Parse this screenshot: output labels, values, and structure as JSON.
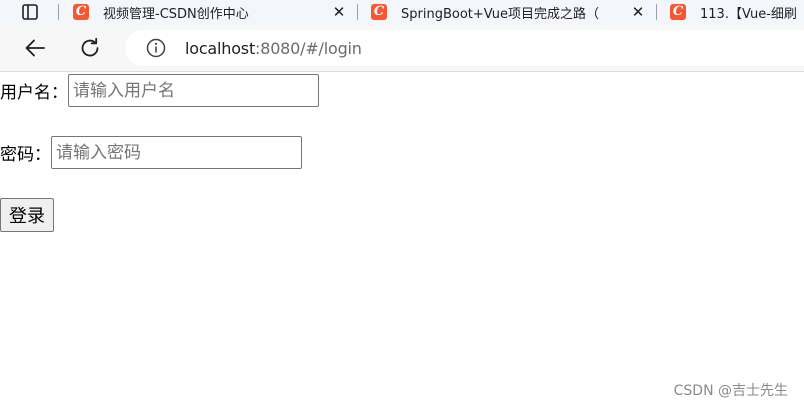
{
  "browser": {
    "tabs": [
      {
        "title": "视频管理-CSDN创作中心",
        "favicon": "csdn-c-icon"
      },
      {
        "title": "SpringBoot+Vue项目完成之路（",
        "favicon": "csdn-c-icon"
      },
      {
        "title": "113.【Vue-细刷",
        "favicon": "csdn-c-icon"
      }
    ],
    "url_host": "localhost",
    "url_rest": ":8080/#/login"
  },
  "login_form": {
    "username_label": "用户名：",
    "username_placeholder": "请输入用户名",
    "password_label": "密码：",
    "password_placeholder": "请输入密码",
    "submit_label": "登录"
  },
  "watermark": "CSDN @吉士先生",
  "colors": {
    "csdn_brand": "#fc5531",
    "tab_strip_bg": "#f3f6fb",
    "toolbar_bg": "#f7f7f7"
  }
}
